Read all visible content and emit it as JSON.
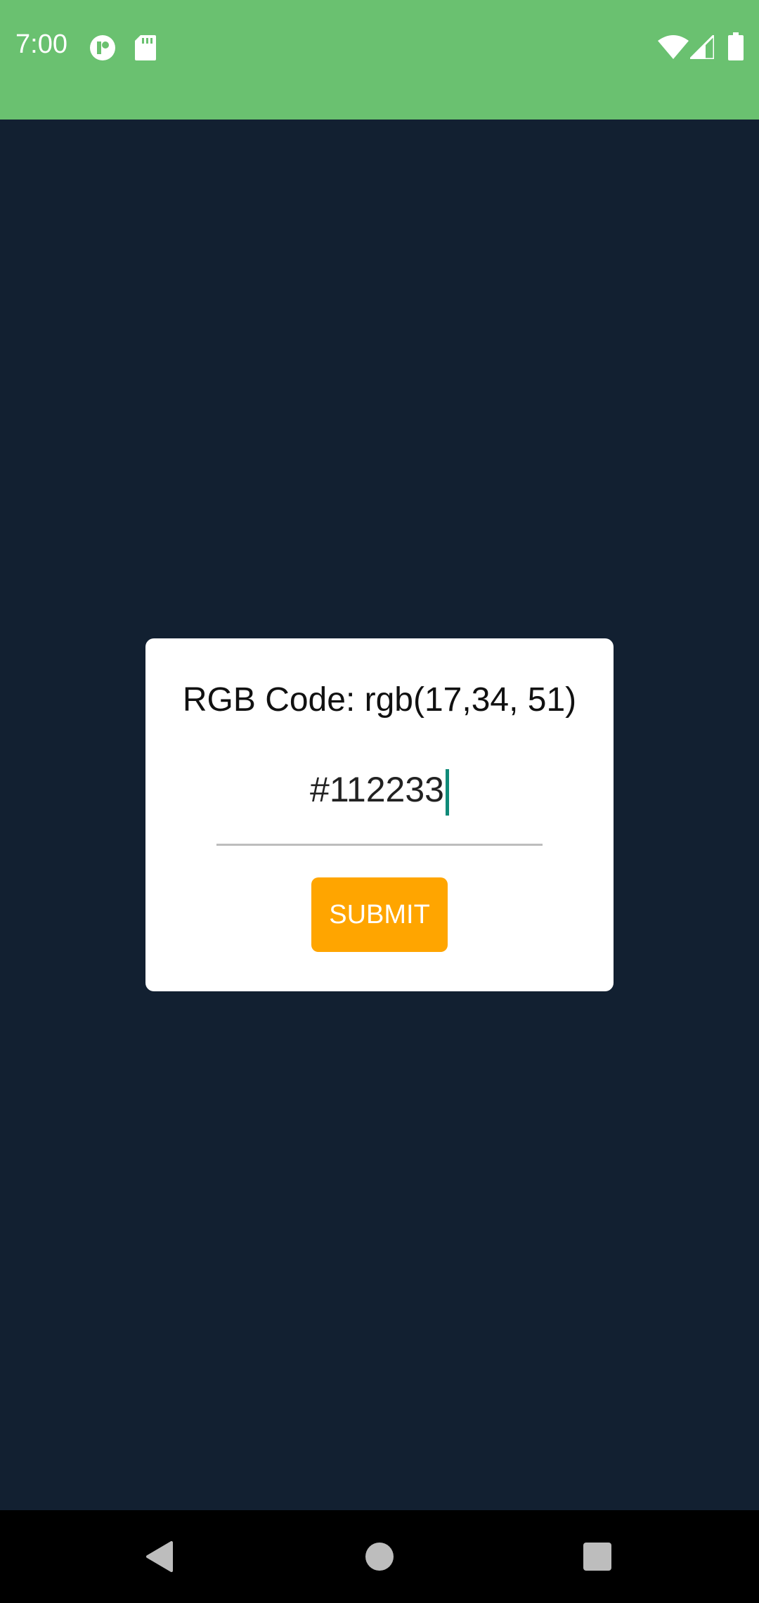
{
  "status_bar": {
    "time": "7:00",
    "background_color": "#6ac170",
    "icons_left": [
      "app-notification-icon",
      "sd-card-icon"
    ],
    "icons_right": [
      "wifi-icon",
      "cell-signal-icon",
      "battery-icon"
    ]
  },
  "app": {
    "background_color": "#122031",
    "rgb_label": "RGB Code: rgb(17,34, 51)",
    "hex_input_value": "#112233",
    "submit_label": "SUBMIT",
    "accent_color": "#ffa500",
    "caret_color": "#0f8a78"
  },
  "nav_bar": {
    "buttons": [
      "back-icon",
      "home-icon",
      "recents-icon"
    ]
  }
}
